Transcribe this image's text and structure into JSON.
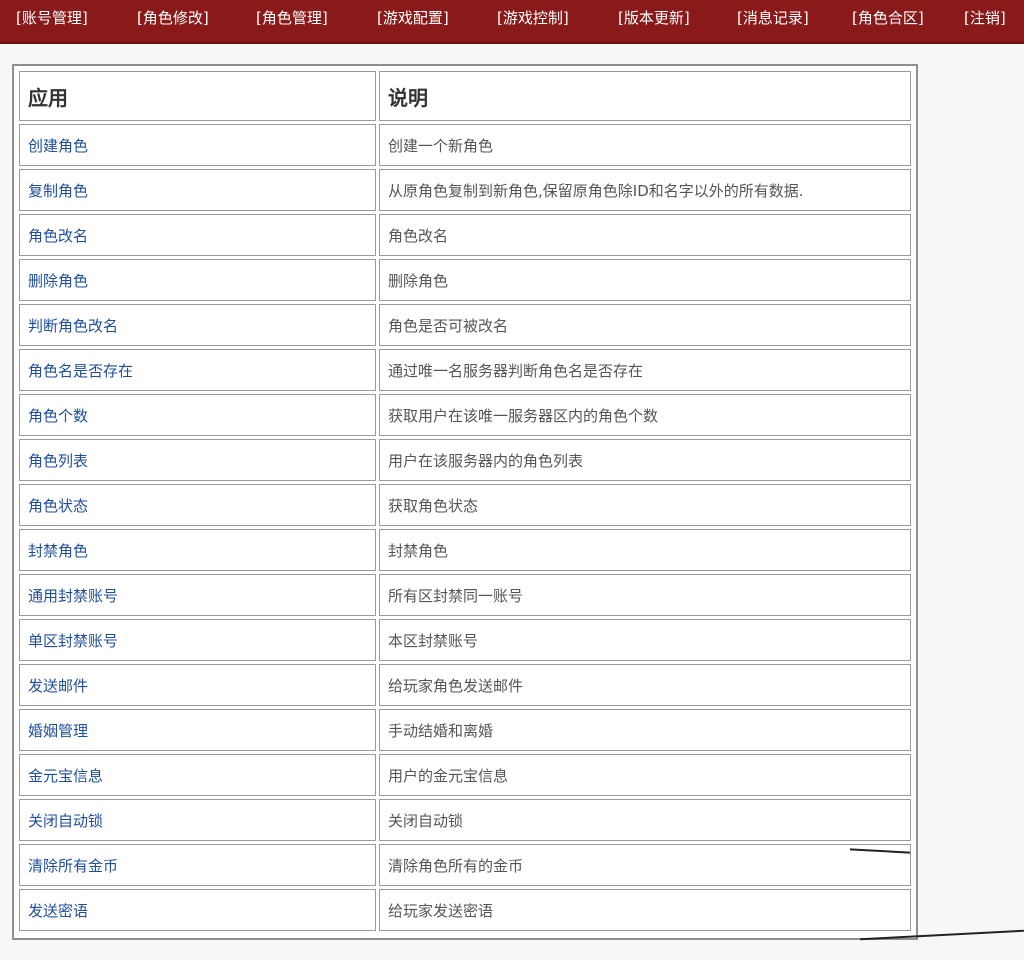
{
  "nav": {
    "items": [
      {
        "label": "[账号管理]"
      },
      {
        "label": "[角色修改]"
      },
      {
        "label": "[角色管理]"
      },
      {
        "label": "[游戏配置]"
      },
      {
        "label": "[游戏控制]"
      },
      {
        "label": "[版本更新]"
      },
      {
        "label": "[消息记录]"
      },
      {
        "label": "[角色合区]"
      },
      {
        "label": "[注销]"
      }
    ]
  },
  "table": {
    "headers": {
      "app": "应用",
      "desc": "说明"
    },
    "rows": [
      {
        "app": "创建角色",
        "desc": "创建一个新角色"
      },
      {
        "app": "复制角色",
        "desc": "从原角色复制到新角色,保留原角色除ID和名字以外的所有数据."
      },
      {
        "app": "角色改名",
        "desc": "角色改名"
      },
      {
        "app": "删除角色",
        "desc": "删除角色"
      },
      {
        "app": "判断角色改名",
        "desc": "角色是否可被改名"
      },
      {
        "app": "角色名是否存在",
        "desc": "通过唯一名服务器判断角色名是否存在"
      },
      {
        "app": "角色个数",
        "desc": "获取用户在该唯一服务器区内的角色个数"
      },
      {
        "app": "角色列表",
        "desc": "用户在该服务器内的角色列表"
      },
      {
        "app": "角色状态",
        "desc": "获取角色状态"
      },
      {
        "app": "封禁角色",
        "desc": "封禁角色"
      },
      {
        "app": "通用封禁账号",
        "desc": "所有区封禁同一账号"
      },
      {
        "app": "单区封禁账号",
        "desc": "本区封禁账号"
      },
      {
        "app": "发送邮件",
        "desc": "给玩家角色发送邮件"
      },
      {
        "app": "婚姻管理",
        "desc": "手动结婚和离婚"
      },
      {
        "app": "金元宝信息",
        "desc": "用户的金元宝信息"
      },
      {
        "app": "关闭自动锁",
        "desc": "关闭自动锁"
      },
      {
        "app": "清除所有金币",
        "desc": "清除角色所有的金币"
      },
      {
        "app": "发送密语",
        "desc": "给玩家发送密语"
      }
    ]
  },
  "colors": {
    "nav_bg": "#8a1a1a",
    "link": "#1f4e9b",
    "text": "#555555"
  }
}
